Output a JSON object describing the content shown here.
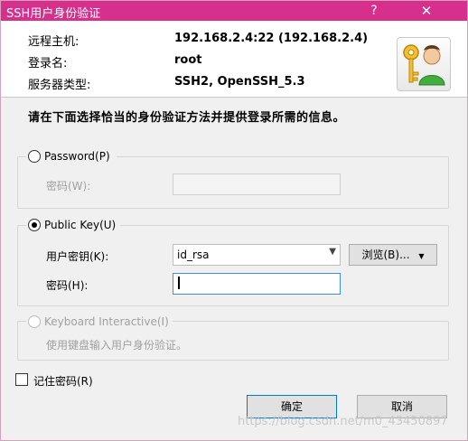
{
  "window": {
    "title": "SSH用户身份验证",
    "help_label": "?",
    "close_label": "✕"
  },
  "info": {
    "host_label": "远程主机:",
    "host_value": "192.168.2.4:22 (192.168.2.4)",
    "login_label": "登录名:",
    "login_value": "root",
    "server_type_label": "服务器类型:",
    "server_type_value": "SSH2, OpenSSH_5.3"
  },
  "instruction": "请在下面选择恰当的身份验证方法并提供登录所需的信息。",
  "password_group": {
    "radio_label": "Password(P)",
    "password_label": "密码(W):",
    "password_value": ""
  },
  "publickey_group": {
    "radio_label": "Public Key(U)",
    "key_label": "用户密钥(K):",
    "key_value": "id_rsa",
    "browse_label": "浏览(B)...",
    "passphrase_label": "密码(H):",
    "passphrase_value": ""
  },
  "keyboard_group": {
    "radio_label": "Keyboard Interactive(I)",
    "description": "使用键盘输入用户身份验证。"
  },
  "remember": {
    "label": "记住密码(R)",
    "checked": false
  },
  "buttons": {
    "ok_label": "确定",
    "cancel_label": "取消"
  },
  "watermark": "https://blog.csdn.net/m0_43450897",
  "colors": {
    "titlebar": "#d6308c",
    "accent_focus": "#3f8fe0",
    "dialog_bg": "#f0f0f0"
  }
}
